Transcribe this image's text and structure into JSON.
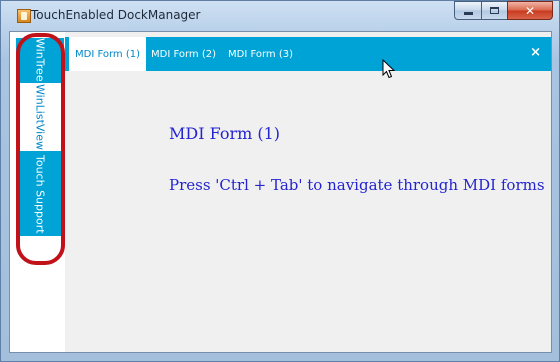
{
  "window": {
    "title": "TouchEnabled DockManager",
    "icon": "app-window-icon",
    "buttons": {
      "minimize": "minimize-icon",
      "maximize": "maximize-icon",
      "close": "✕"
    }
  },
  "dock": {
    "tabs": [
      {
        "label": "WinTree",
        "active": false
      },
      {
        "label": "WinListView",
        "active": true
      },
      {
        "label": "Touch Support",
        "active": false
      }
    ],
    "annotation_color": "#c1121a"
  },
  "mdi": {
    "tabs": [
      {
        "label": "MDI Form (1)",
        "active": true
      },
      {
        "label": "MDI Form (2)",
        "active": false
      },
      {
        "label": "MDI Form (3)",
        "active": false
      }
    ],
    "close_glyph": "×",
    "accent": "#00a3d6"
  },
  "content": {
    "title": "MDI Form (1)",
    "hint": "Press 'Ctrl + Tab' to navigate through MDI forms",
    "text_color": "#2424d0"
  }
}
